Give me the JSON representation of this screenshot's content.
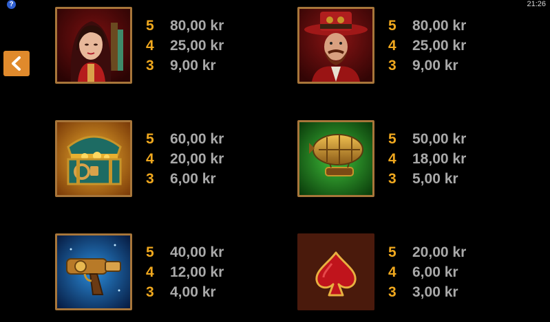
{
  "topbar": {
    "help_icon": "?",
    "clock": "21:26"
  },
  "nav": {
    "back_icon": "chevron-left-icon"
  },
  "symbols": [
    {
      "name": "lady",
      "icon": "lady-portrait-icon",
      "pays": [
        {
          "count": "5",
          "amount": "80,00 kr"
        },
        {
          "count": "4",
          "amount": "25,00 kr"
        },
        {
          "count": "3",
          "amount": "9,00 kr"
        }
      ]
    },
    {
      "name": "captain",
      "icon": "captain-portrait-icon",
      "pays": [
        {
          "count": "5",
          "amount": "80,00 kr"
        },
        {
          "count": "4",
          "amount": "25,00 kr"
        },
        {
          "count": "3",
          "amount": "9,00 kr"
        }
      ]
    },
    {
      "name": "treasure-chest",
      "icon": "treasure-chest-icon",
      "pays": [
        {
          "count": "5",
          "amount": "60,00 kr"
        },
        {
          "count": "4",
          "amount": "20,00 kr"
        },
        {
          "count": "3",
          "amount": "6,00 kr"
        }
      ]
    },
    {
      "name": "airship",
      "icon": "airship-icon",
      "pays": [
        {
          "count": "5",
          "amount": "50,00 kr"
        },
        {
          "count": "4",
          "amount": "18,00 kr"
        },
        {
          "count": "3",
          "amount": "5,00 kr"
        }
      ]
    },
    {
      "name": "ray-gun",
      "icon": "ray-gun-icon",
      "pays": [
        {
          "count": "5",
          "amount": "40,00 kr"
        },
        {
          "count": "4",
          "amount": "12,00 kr"
        },
        {
          "count": "3",
          "amount": "4,00 kr"
        }
      ]
    },
    {
      "name": "spade",
      "icon": "spade-icon",
      "pays": [
        {
          "count": "5",
          "amount": "20,00 kr"
        },
        {
          "count": "4",
          "amount": "6,00 kr"
        },
        {
          "count": "3",
          "amount": "3,00 kr"
        }
      ]
    }
  ],
  "colors": {
    "count": "#f0a81e",
    "amount": "#a9a9a9",
    "back_button": "#e08a2c",
    "frame": "#a8763a"
  }
}
